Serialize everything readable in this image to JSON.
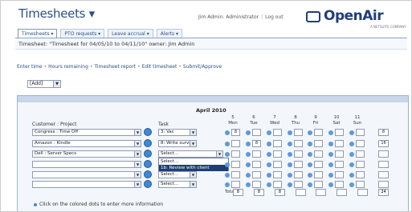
{
  "app": {
    "title": "Timesheets ▾"
  },
  "user_bar": {
    "admin": "Jim Admin: Administrator",
    "logout": "Log out"
  },
  "logo": {
    "text": "OpenAir",
    "sub": "A NETSUITE COMPANY"
  },
  "tabs": [
    "Timesheets ▾",
    "PTO requests ▾",
    "Leave accrual ▾",
    "Alerts ▾"
  ],
  "crumb": "Timesheet: \"Timesheet for 04/05/10 to 04/11/10\" owner: Jim Admin",
  "subnav": [
    "Enter time",
    "Hours remaining",
    "Timesheet report",
    "Edit timesheet",
    "Submit/Approve"
  ],
  "action_select": "[Add]",
  "grid": {
    "month": "April 2010",
    "customer_project_header": "Customer : Project",
    "task_header": "Task",
    "days": [
      {
        "num": "5",
        "name": "Mon"
      },
      {
        "num": "6",
        "name": "Tue"
      },
      {
        "num": "7",
        "name": "Wed"
      },
      {
        "num": "8",
        "name": "Thu"
      },
      {
        "num": "9",
        "name": "Fri"
      },
      {
        "num": "10",
        "name": "Sat"
      },
      {
        "num": "11",
        "name": "Sun"
      }
    ],
    "rows": [
      {
        "project": "Congress : Time Off",
        "task": "3: Vac"
      },
      {
        "project": "Amazon : Kindle",
        "task": "8: Write survey"
      },
      {
        "project": "Dell : Server Specs",
        "task": "Select..."
      },
      {
        "project": "",
        "task": "Select..."
      },
      {
        "project": "",
        "task": "Select..."
      },
      {
        "project": "",
        "task": "Select..."
      }
    ],
    "row_values": [
      [
        "8",
        "",
        "",
        "",
        "",
        "",
        "",
        "8"
      ],
      [
        "",
        "8",
        "",
        "",
        "",
        "",
        "",
        "16"
      ]
    ],
    "dropdown_options": [
      "Select...",
      "1b: Review with client"
    ],
    "total_label": "Total",
    "totals": [
      "8",
      "8",
      "8",
      "",
      "",
      "",
      "",
      "24"
    ]
  },
  "footnote": "Click on the colored dots to enter more information"
}
